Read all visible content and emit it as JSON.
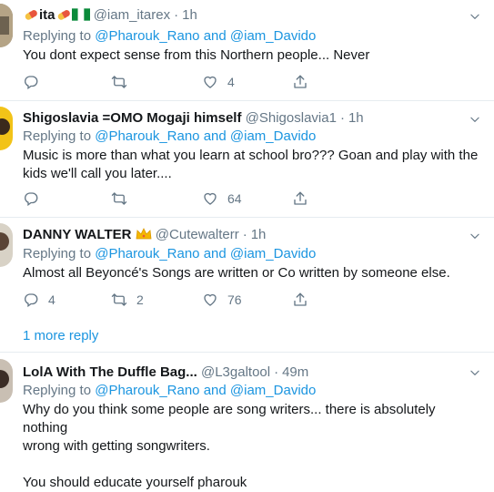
{
  "colors": {
    "link": "#1b95e0",
    "muted": "#657786",
    "text": "#14171a",
    "divider": "#e6ecf0"
  },
  "tweets": [
    {
      "name": "ita",
      "handle": "@iam_itarex",
      "time": "1h",
      "replying_prefix": "Replying to",
      "replying_user1": "@Pharouk_Rano",
      "replying_and": "and",
      "replying_user2": "@iam_Davido",
      "text": "You dont expect sense from this Northern people...  Never",
      "replies": "",
      "retweets": "",
      "likes": "4"
    },
    {
      "name": "Shigoslavia =OMO Mogaji himself",
      "handle": "@Shigoslavia1",
      "time": "1h",
      "replying_prefix": "Replying to",
      "replying_user1": "@Pharouk_Rano",
      "replying_and": "and",
      "replying_user2": "@iam_Davido",
      "text_line1": "Music is more than what you learn at school bro??? Goan and play with the",
      "text_line2": "kids we'll call you later....",
      "replies": "",
      "retweets": "",
      "likes": "64"
    },
    {
      "name": "DANNY WALTER",
      "handle": "@Cutewalterr",
      "time": "1h",
      "replying_prefix": "Replying to",
      "replying_user1": "@Pharouk_Rano",
      "replying_and": "and",
      "replying_user2": "@iam_Davido",
      "text": "Almost all Beyoncé's Songs are written or Co written by someone else.",
      "replies": "4",
      "retweets": "2",
      "likes": "76"
    },
    {
      "name": "LolA With The Duffle Bag...",
      "handle": "@L3galtool",
      "time": "49m",
      "replying_prefix": "Replying to",
      "replying_user1": "@Pharouk_Rano",
      "replying_and": "and",
      "replying_user2": "@iam_Davido",
      "text_line1": "Why do you think some people are song writers... there is absolutely nothing",
      "text_line2": "wrong with getting songwriters.",
      "text_line3": "You should educate yourself pharouk"
    }
  ],
  "more_reply": "1 more reply",
  "icons": [
    "pill-icon",
    "nigeria-flag-icon",
    "crown-icon",
    "reply-icon",
    "retweet-icon",
    "like-icon",
    "share-icon",
    "chevron-down-icon"
  ]
}
